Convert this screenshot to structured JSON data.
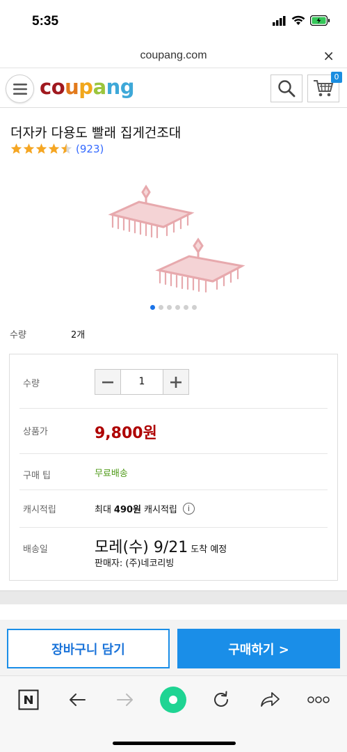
{
  "status": {
    "time": "5:35"
  },
  "browser": {
    "url": "coupang.com",
    "close_glyph": "×"
  },
  "header": {
    "logo_letters": [
      "c",
      "o",
      "u",
      "p",
      "a",
      "n",
      "g"
    ],
    "logo_colors": [
      "#a0181e",
      "#a0181e",
      "#e27a1c",
      "#f1a71c",
      "#9bc53d",
      "#3ea8d8",
      "#3ea8d8"
    ],
    "cart_count": "0"
  },
  "product": {
    "title": "더자카 다용도 빨래 집게건조대",
    "rating_stars": 4.5,
    "review_count": "(923)",
    "image_dots": 6,
    "active_dot": 0,
    "quantity_label": "수량",
    "quantity_value": "2개"
  },
  "options": {
    "qty_label": "수량",
    "qty_value": "1",
    "price_label": "상품가",
    "price": "9,800원",
    "tip_label": "구매 팁",
    "tip_value": "무료배송",
    "cash_label": "캐시적립",
    "cash_prefix": "최대",
    "cash_amount": "490원",
    "cash_suffix": "캐시적립",
    "info_glyph": "i",
    "delivery_label": "배송일",
    "delivery_date": "모레(수) 9/21",
    "delivery_suffix": "도착 예정",
    "seller": "판매자: (주)네코리빙"
  },
  "buttons": {
    "add_to_cart": "장바구니 담기",
    "buy_now": "구매하기 >"
  },
  "colors": {
    "accent": "#1a8ee8",
    "price": "#ae0000",
    "tip": "#4f9a18",
    "star": "#f5a623"
  }
}
